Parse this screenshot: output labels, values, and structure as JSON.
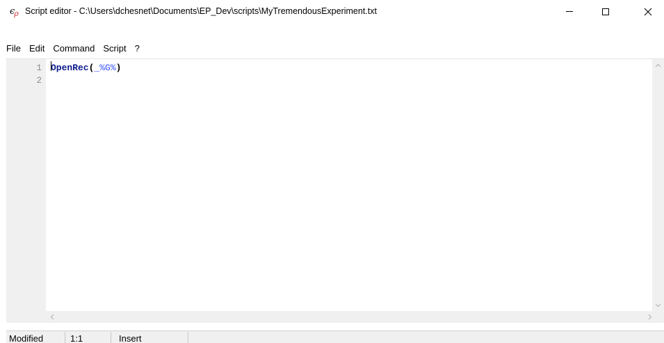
{
  "window": {
    "title": "Script editor - C:\\Users\\dchesnet\\Documents\\EP_Dev\\scripts\\MyTremendousExperiment.txt",
    "icon_main": "ϵ",
    "icon_sub": "ρ",
    "minimize_glyph": "",
    "close_glyph": "✕"
  },
  "menu": {
    "items": [
      "File",
      "Edit",
      "Command",
      "Script",
      "?"
    ]
  },
  "editor": {
    "line_numbers": [
      "1",
      "2"
    ],
    "lines": [
      {
        "func": "OpenRec",
        "open": "(",
        "arg": "_%G%",
        "close": ")"
      },
      {
        "text": ""
      }
    ],
    "scroll_up": "▲",
    "scroll_down": "▼",
    "scroll_left": "<",
    "scroll_right": ">"
  },
  "statusbar": {
    "state": "Modified",
    "position": "1:1",
    "mode": "Insert"
  },
  "colors": {
    "function": "#0b1a8c",
    "variable": "#3a55ff",
    "gutter_bg": "#f0f0f0",
    "line_number": "#8a8a8a"
  }
}
